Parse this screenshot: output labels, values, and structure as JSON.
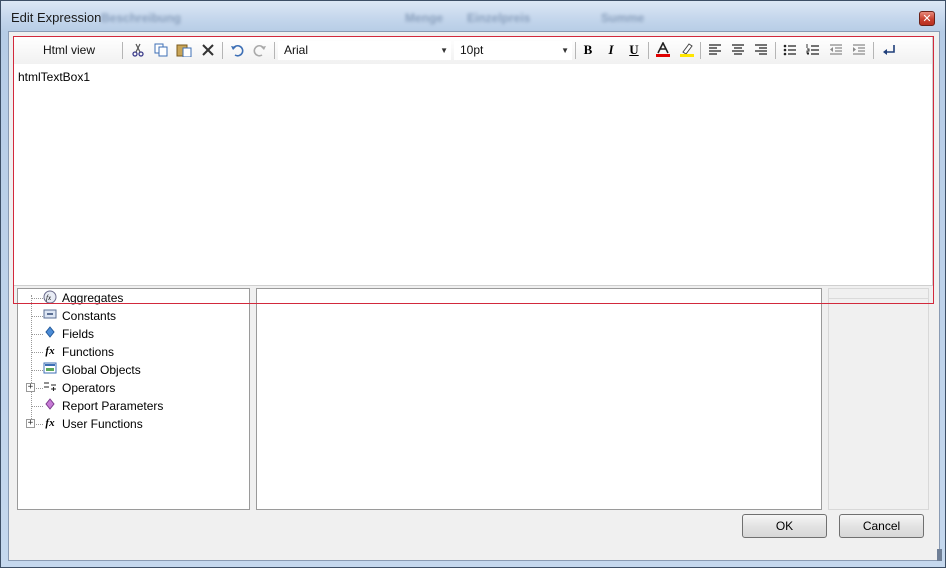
{
  "window": {
    "title": "Edit Expression",
    "background_ghost_headers": [
      "Beschreibung",
      "Menge",
      "Einzelpreis",
      "Summe"
    ]
  },
  "toolbar": {
    "html_view_label": "Html view",
    "font_family_value": "Arial",
    "font_size_value": "10pt",
    "icons": [
      "cut-icon",
      "copy-icon",
      "paste-icon",
      "delete-icon",
      "undo-icon",
      "redo-icon",
      "bold-icon",
      "italic-icon",
      "underline-icon",
      "font-color-icon",
      "highlight-icon",
      "align-left-icon",
      "align-center-icon",
      "align-right-icon",
      "bullet-list-icon",
      "numbered-list-icon",
      "outdent-icon",
      "indent-icon",
      "line-break-icon"
    ]
  },
  "editor": {
    "content": "htmlTextBox1"
  },
  "tree": {
    "items": [
      {
        "label": "Aggregates",
        "icon": "aggregate-fx-icon",
        "expandable": false
      },
      {
        "label": "Constants",
        "icon": "constants-icon",
        "expandable": false
      },
      {
        "label": "Fields",
        "icon": "fields-icon",
        "expandable": false
      },
      {
        "label": "Functions",
        "icon": "function-fx-icon",
        "expandable": false
      },
      {
        "label": "Global Objects",
        "icon": "global-objects-icon",
        "expandable": false
      },
      {
        "label": "Operators",
        "icon": "operators-icon",
        "expandable": true
      },
      {
        "label": "Report Parameters",
        "icon": "report-parameters-icon",
        "expandable": false
      },
      {
        "label": "User Functions",
        "icon": "user-functions-fx-icon",
        "expandable": true
      }
    ]
  },
  "buttons": {
    "ok": "OK",
    "cancel": "Cancel"
  },
  "colors": {
    "selection_frame": "#d2293c",
    "font_color_bar": "#e00000",
    "highlight_bar": "#ffe600"
  }
}
